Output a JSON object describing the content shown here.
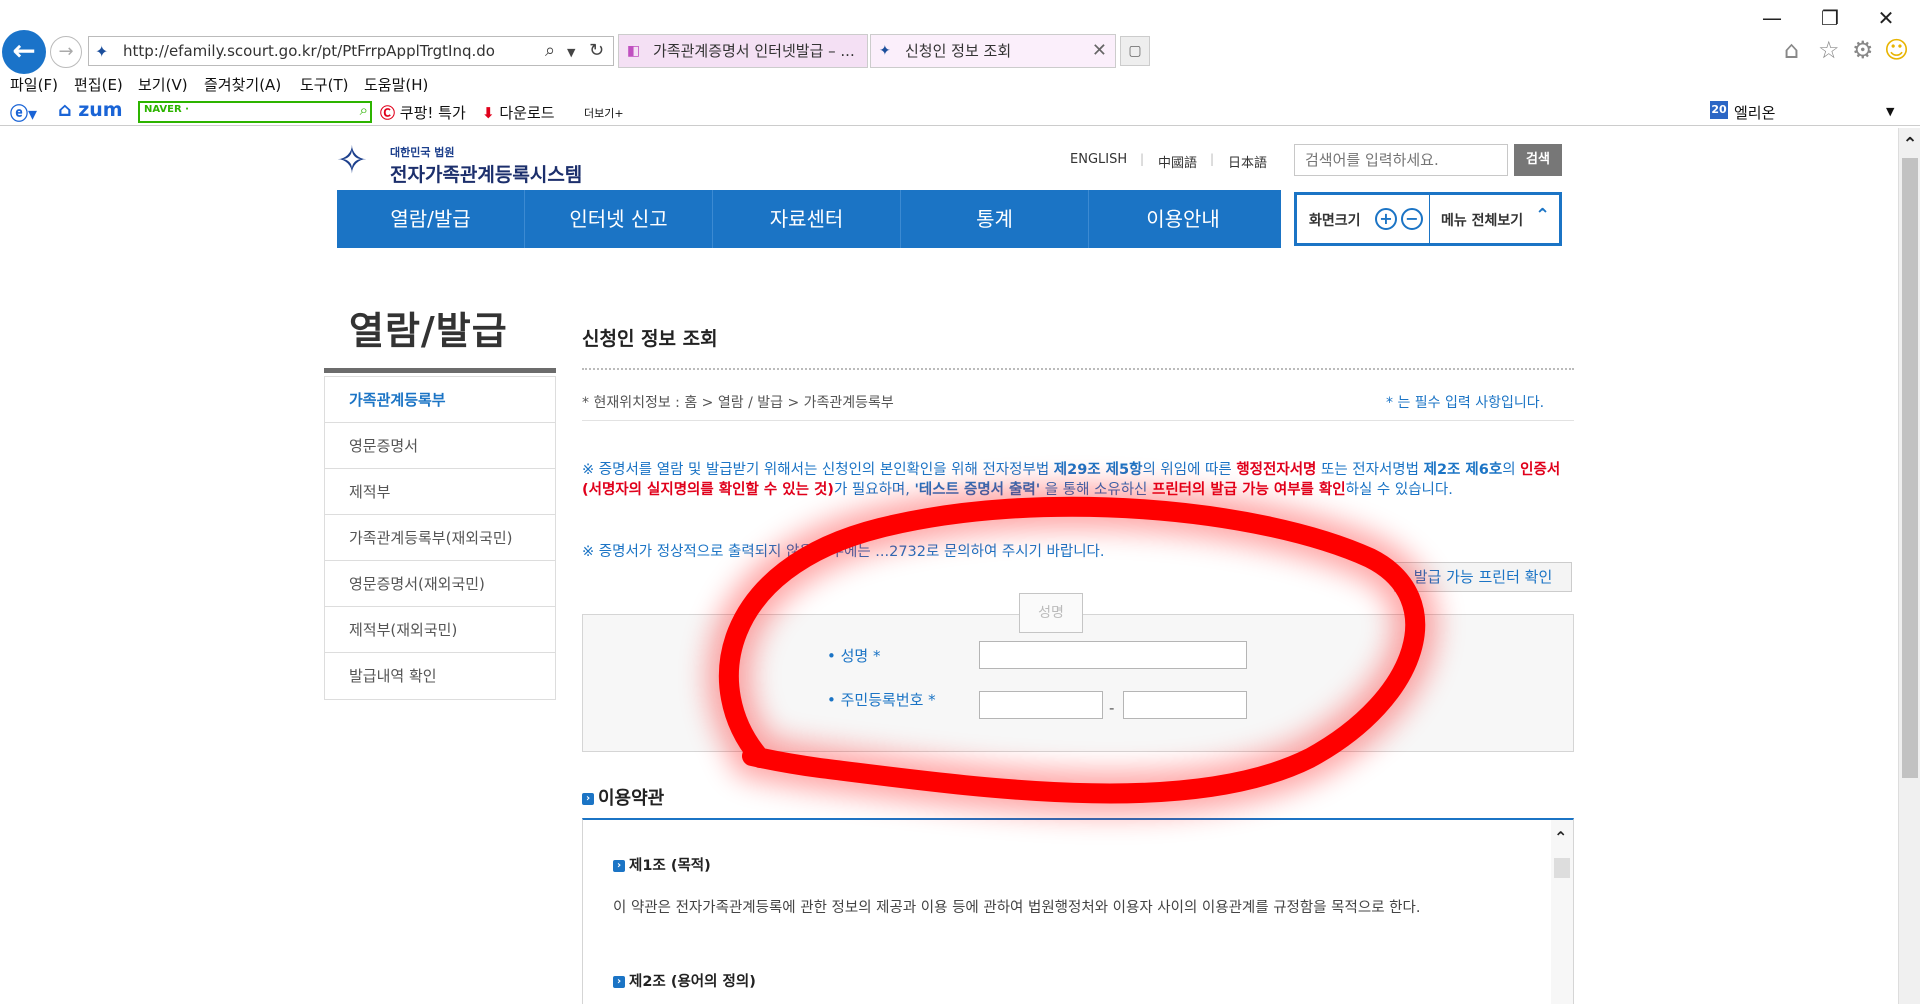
{
  "window": {
    "minimize_glyph": "—",
    "restore_glyph": "❐",
    "close_glyph": "✕"
  },
  "browser": {
    "url": "http://efamily.scourt.go.kr/pt/PtFrrpApplTrgtInq.do",
    "tabs": [
      {
        "label": "가족관계증명서 인터넷발급 – ..."
      },
      {
        "label": "신청인 정보 조회"
      }
    ],
    "tab_close_glyph": "✕",
    "menu": [
      "파일(F)",
      "편집(E)",
      "보기(V)",
      "즐겨찾기(A)",
      "도구(T)",
      "도움말(H)"
    ],
    "toolbar": {
      "zum": "zum",
      "naver": "NAVER ·",
      "coupang": "쿠팡! 특가",
      "download": "다운로드",
      "more": "더보기+",
      "elion_badge": "20",
      "elion": "엘리온"
    },
    "icons": {
      "back": "back-arrow-icon",
      "forward": "forward-arrow-icon",
      "search": "magnifier-icon",
      "refresh": "refresh-icon",
      "home": "home-icon",
      "favorites": "star-icon",
      "settings": "gear-icon",
      "smiley": "smiley-icon"
    }
  },
  "site": {
    "logo_sub": "대한민국 법원",
    "logo_title": "전자가족관계등록시스템",
    "languages": [
      "ENGLISH",
      "中國語",
      "日本語"
    ],
    "search_placeholder": "검색어를 입력하세요.",
    "search_button": "검색",
    "gnb": [
      "열람/발급",
      "인터넷 신고",
      "자료센터",
      "통계",
      "이용안내"
    ],
    "zoom_label": "화면크기",
    "zoom_plus": "+",
    "zoom_minus": "−",
    "all_menu": "메뉴 전체보기"
  },
  "sidebar": {
    "title": "열람/발급",
    "items": [
      {
        "label": "가족관계등록부",
        "active": true
      },
      {
        "label": "영문증명서",
        "active": false
      },
      {
        "label": "제적부",
        "active": false
      },
      {
        "label": "가족관계등록부(재외국민)",
        "active": false
      },
      {
        "label": "영문증명서(재외국민)",
        "active": false
      },
      {
        "label": "제적부(재외국민)",
        "active": false
      },
      {
        "label": "발급내역 확인",
        "active": false
      }
    ]
  },
  "content": {
    "title": "신청인 정보 조회",
    "location": "* 현재위치정보 : 홈 > 열람 / 발급 > 가족관계등록부",
    "required_note": "* 는 필수 입력 사항입니다.",
    "notice1": {
      "p1": "※ 증명서를 열람 및 발급받기 위해서는 신청인의 본인확인을 위해 전자정부법 ",
      "b1": "제29조 제5항",
      "p2": "의 위임에 따른 ",
      "r1": "행정전자서명",
      "p3": " 또는 전자서명법 ",
      "b2": "제2조 제6호",
      "p4": "의 ",
      "r2": "인증서(서명자의 실지명의를 확인할 수 있는 것)",
      "p5": "가 필요하며, ",
      "b3": "'테스트 증명서 출력'",
      "p6": " 을 통해 소유하신 ",
      "r3": "프린터의 발급 가능 여부를 확인",
      "p7": "하실 수 있습니다."
    },
    "notice2": "※ 증명서가 정상적으로 출력되지 않을 경우에는 ...2732로 문의하여 주시기 바랍니다.",
    "printer_button": "발급 가능 프린터 확인",
    "form": {
      "floating_button": "성명",
      "name_label": "• 성명 *",
      "rrn_label": "• 주민등록번호 *",
      "rrn_separator": "-",
      "name_value": "",
      "rrn_front_value": "",
      "rrn_back_value": ""
    },
    "terms": {
      "title": "이용약관",
      "title_icon": "›",
      "articles": [
        {
          "title": "제1조 (목적)",
          "body": "이 약관은 전자가족관계등록에 관한 정보의 제공과 이용 등에 관하여 법원행정처와 이용자 사이의 이용관계를 규정함을 목적으로 한다."
        },
        {
          "title": "제2조 (용어의 정의)",
          "body": ""
        }
      ]
    }
  },
  "annotation": {
    "color": "#ff0000",
    "shape": "hand-drawn-ellipse"
  }
}
